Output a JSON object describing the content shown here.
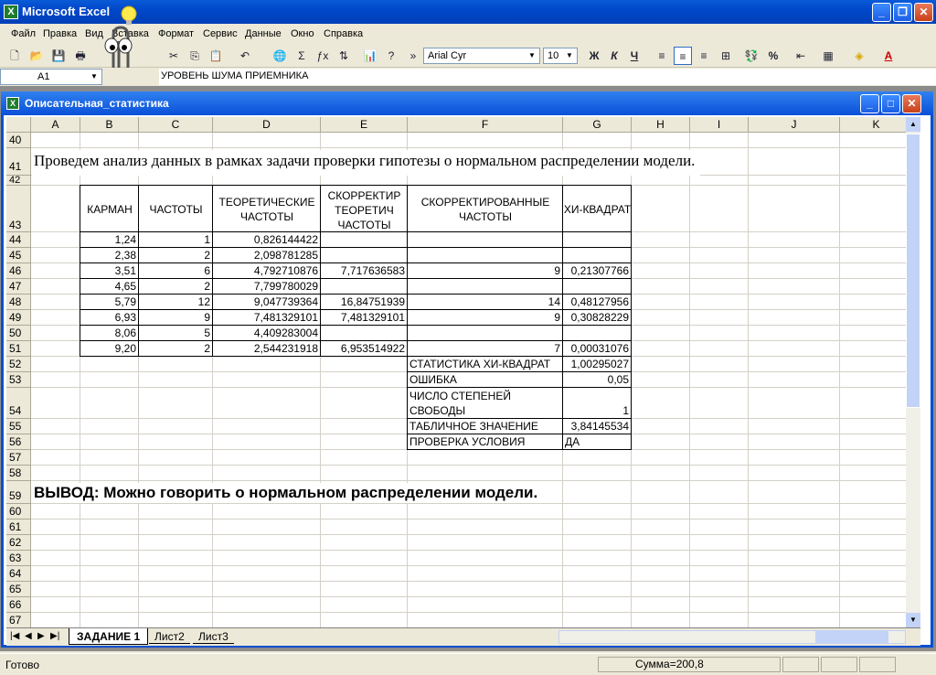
{
  "app": {
    "title": "Microsoft Excel"
  },
  "menu": [
    "Файл",
    "Правка",
    "Вид",
    "Вставка",
    "Формат",
    "Сервис",
    "Данные",
    "Окно",
    "Справка"
  ],
  "toolbar": {
    "font": "Arial Cyr",
    "size": "10",
    "bold": "Ж",
    "italic": "К",
    "underline": "Ч",
    "percent": "%"
  },
  "formula": {
    "cell": "A1",
    "value": "УРОВЕНЬ ШУМА ПРИЕМНИКА"
  },
  "workbook": {
    "title": "Описательная_статистика"
  },
  "columns": [
    "A",
    "B",
    "C",
    "D",
    "E",
    "F",
    "G",
    "H",
    "I",
    "J",
    "K"
  ],
  "rows": [
    "40",
    "41",
    "42",
    "43",
    "44",
    "45",
    "46",
    "47",
    "48",
    "49",
    "50",
    "51",
    "52",
    "53",
    "54",
    "55",
    "56",
    "57",
    "58",
    "59",
    "60",
    "61",
    "62",
    "63",
    "64",
    "65",
    "66",
    "67"
  ],
  "texts": {
    "r41": "Проведем анализ данных в рамках задачи проверки гипотезы о нормальном распределении модели.",
    "r59": "ВЫВОД: Можно говорить о нормальном распределении модели."
  },
  "table_headers": [
    "КАРМАН",
    "ЧАСТОТЫ",
    "ТЕОРЕТИЧЕСКИЕ ЧАСТОТЫ",
    "СКОРРЕКТИР ТЕОРЕТИЧ ЧАСТОТЫ",
    "СКОРРЕКТИРОВАННЫЕ ЧАСТОТЫ",
    "ХИ-КВАДРАТ"
  ],
  "table_rows": [
    [
      "1,24",
      "1",
      "0,826144422",
      "",
      "",
      ""
    ],
    [
      "2,38",
      "2",
      "2,098781285",
      "",
      "",
      ""
    ],
    [
      "3,51",
      "6",
      "4,792710876",
      "7,717636583",
      "9",
      "0,21307766"
    ],
    [
      "4,65",
      "2",
      "7,799780029",
      "",
      "",
      ""
    ],
    [
      "5,79",
      "12",
      "9,047739364",
      "16,84751939",
      "14",
      "0,48127956"
    ],
    [
      "6,93",
      "9",
      "7,481329101",
      "7,481329101",
      "9",
      "0,30828229"
    ],
    [
      "8,06",
      "5",
      "4,409283004",
      "",
      "",
      ""
    ],
    [
      "9,20",
      "2",
      "2,544231918",
      "6,953514922",
      "7",
      "0,00031076"
    ]
  ],
  "stats": [
    {
      "label": "СТАТИСТИКА ХИ-КВАДРАТ",
      "value": "1,00295027"
    },
    {
      "label": "ОШИБКА",
      "value": "0,05"
    },
    {
      "label": "ЧИСЛО СТЕПЕНЕЙ СВОБОДЫ",
      "value": "1"
    },
    {
      "label": "ТАБЛИЧНОЕ ЗНАЧЕНИЕ",
      "value": "3,84145534"
    },
    {
      "label": "ПРОВЕРКА УСЛОВИЯ",
      "value": "ДА"
    }
  ],
  "sheets": [
    "ЗАДАНИЕ 1",
    "Лист2",
    "Лист3"
  ],
  "status": {
    "ready": "Готово",
    "sum": "Сумма=200,8"
  }
}
